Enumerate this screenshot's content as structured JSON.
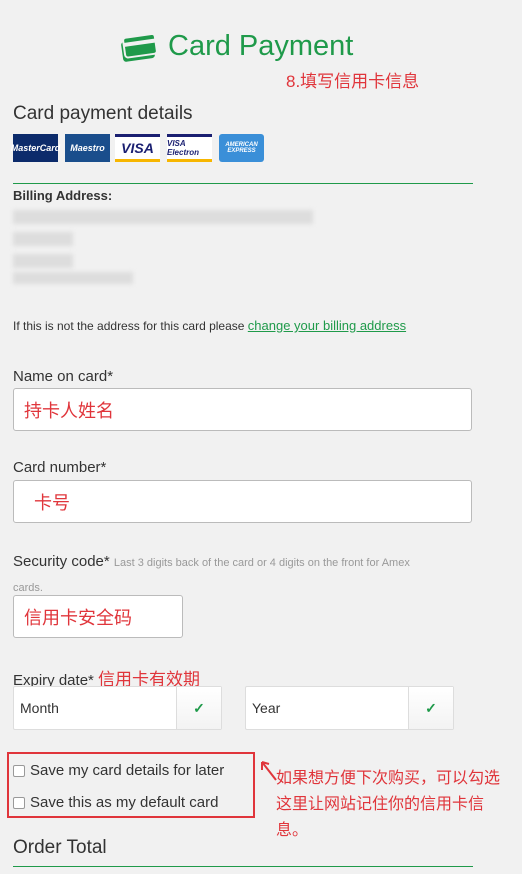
{
  "header": {
    "title": "Card Payment",
    "annotation": "8.填写信用卡信息"
  },
  "section_title": "Card payment details",
  "cards": [
    "MasterCard",
    "Maestro",
    "VISA",
    "VISA Electron",
    "AMERICAN EXPRESS"
  ],
  "billing": {
    "label": "Billing Address:",
    "note": "If this is not the address for this card please ",
    "link": "change your billing address"
  },
  "name": {
    "label": "Name on card*",
    "value": "持卡人姓名"
  },
  "number": {
    "label": "Card number*",
    "value": "卡号"
  },
  "security": {
    "label": "Security code*",
    "hint": "Last 3 digits back of the card or 4 digits on the front for Amex",
    "hint2": "cards.",
    "value": "信用卡安全码"
  },
  "expiry": {
    "label": "Expiry date*",
    "annotation": "信用卡有效期",
    "month": "Month",
    "year": "Year"
  },
  "save": {
    "later": "Save my card details for later",
    "default": "Save this as my default card",
    "annotation": "如果想方便下次购买，可以勾选这里让网站记住你的信用卡信息。"
  },
  "order_total": "Order Total",
  "colors": {
    "accent": "#1f9a4a",
    "annotation": "#e0353b"
  }
}
